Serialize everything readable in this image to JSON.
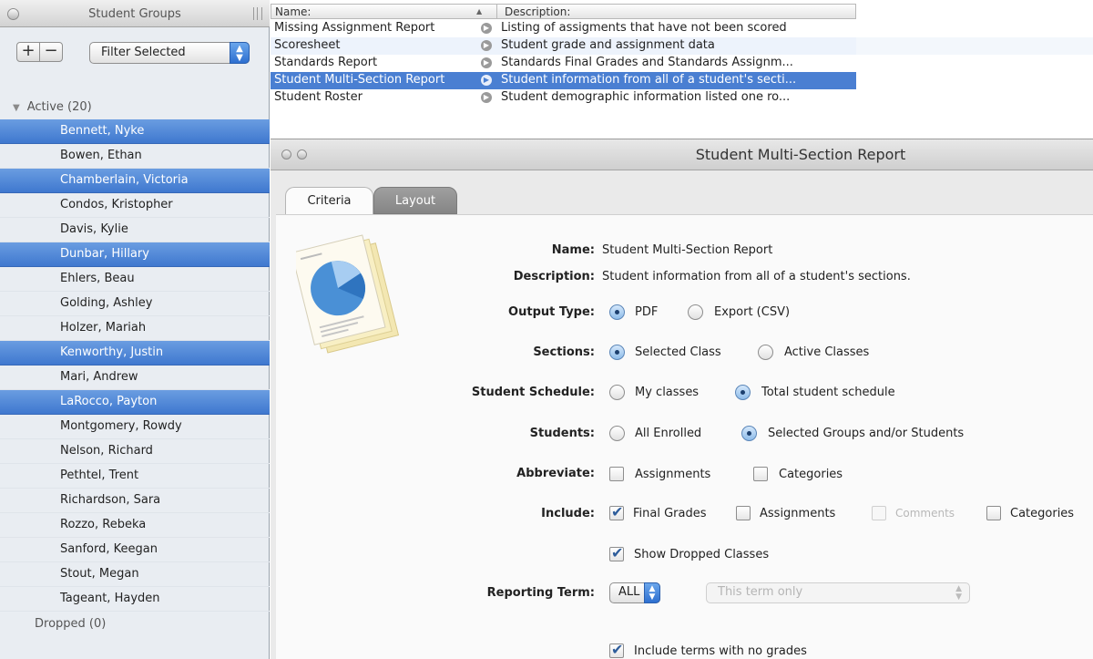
{
  "sidebar": {
    "title": "Student Groups",
    "plus_label": "+",
    "minus_label": "−",
    "filter": {
      "selected": "Filter Selected"
    },
    "active_group": "Active (20)",
    "dropped_group": "Dropped (0)",
    "students": [
      {
        "name": "Bennett, Nyke",
        "selected": true
      },
      {
        "name": "Bowen, Ethan",
        "selected": false
      },
      {
        "name": "Chamberlain, Victoria",
        "selected": true
      },
      {
        "name": "Condos, Kristopher",
        "selected": false
      },
      {
        "name": "Davis, Kylie",
        "selected": false
      },
      {
        "name": "Dunbar, Hillary",
        "selected": true
      },
      {
        "name": "Ehlers, Beau",
        "selected": false
      },
      {
        "name": "Golding, Ashley",
        "selected": false
      },
      {
        "name": "Holzer, Mariah",
        "selected": false
      },
      {
        "name": "Kenworthy, Justin",
        "selected": true
      },
      {
        "name": "Mari, Andrew",
        "selected": false
      },
      {
        "name": "LaRocco, Payton",
        "selected": true
      },
      {
        "name": "Montgomery, Rowdy",
        "selected": false
      },
      {
        "name": "Nelson, Richard",
        "selected": false
      },
      {
        "name": "Pethtel, Trent",
        "selected": false
      },
      {
        "name": "Richardson, Sara",
        "selected": false
      },
      {
        "name": "Rozzo, Rebeka",
        "selected": false
      },
      {
        "name": "Sanford, Keegan",
        "selected": false
      },
      {
        "name": "Stout, Megan",
        "selected": false
      },
      {
        "name": "Tageant, Hayden",
        "selected": false
      }
    ]
  },
  "reports": {
    "col_name": "Name:",
    "col_description": "Description:",
    "rows": [
      {
        "name": "Missing Assignment Report",
        "description": "Listing of assigments that have not been scored",
        "selected": false
      },
      {
        "name": "Scoresheet",
        "description": "Student grade and assignment data",
        "selected": false
      },
      {
        "name": "Standards Report",
        "description": "Standards Final Grades and Standards Assignm...",
        "selected": false
      },
      {
        "name": "Student Multi-Section Report",
        "description": "Student information from all of a student's secti...",
        "selected": true
      },
      {
        "name": "Student Roster",
        "description": "Student demographic information listed one ro...",
        "selected": false
      }
    ]
  },
  "panel": {
    "title": "Student Multi-Section Report",
    "tabs": {
      "criteria": "Criteria",
      "layout": "Layout"
    },
    "name_label": "Name:",
    "name_value": "Student Multi-Section Report",
    "description_label": "Description:",
    "description_value": "Student information from all of a student's sections.",
    "output_type": {
      "label": "Output Type:",
      "options": [
        "PDF",
        "Export (CSV)"
      ],
      "selected": "PDF"
    },
    "sections": {
      "label": "Sections:",
      "options": [
        "Selected Class",
        "Active Classes"
      ],
      "selected": "Selected Class"
    },
    "student_schedule": {
      "label": "Student Schedule:",
      "options": [
        "My classes",
        "Total student schedule"
      ],
      "selected": "Total student schedule"
    },
    "students": {
      "label": "Students:",
      "options": [
        "All Enrolled",
        "Selected Groups and/or Students"
      ],
      "selected": "Selected Groups and/or Students"
    },
    "abbreviate": {
      "label": "Abbreviate:",
      "assignments": "Assignments",
      "categories": "Categories"
    },
    "include": {
      "label": "Include:",
      "final_grades": "Final Grades",
      "assignments": "Assignments",
      "comments": "Comments",
      "categories": "Categories"
    },
    "show_dropped": "Show Dropped Classes",
    "reporting_term": {
      "label": "Reporting Term:",
      "value": "ALL",
      "scope": "This term only"
    },
    "include_no_grades": "Include terms with no grades"
  },
  "colors": {
    "selection": "#4a7fd2",
    "accent": "#2e6fd0"
  }
}
